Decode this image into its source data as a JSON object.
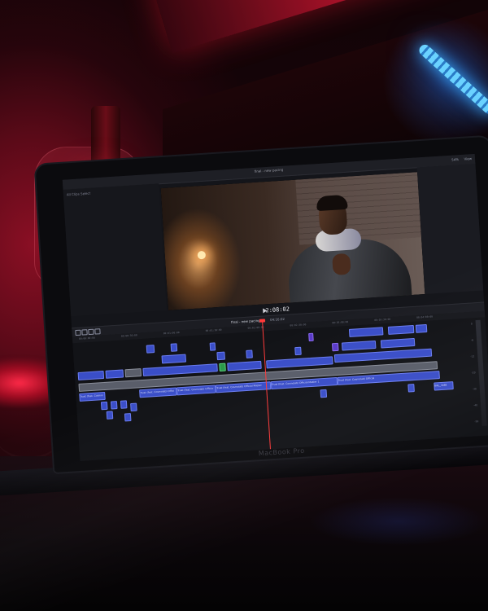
{
  "app": {
    "window_title": "final - new pacing",
    "library_label": "All Clips  Select",
    "zoom": "54%",
    "view_label": "View"
  },
  "viewer": {
    "timecode": "2:08:02"
  },
  "timeline": {
    "project_name": "final - new pacing",
    "duration": "04:16:02",
    "ruler_ticks": [
      "00:00:00:00",
      "00:00:30:00",
      "00:01:00:00",
      "00:01:30:00",
      "00:02:00:00",
      "00:02:30:00",
      "00:03:00:00",
      "00:03:30:00",
      "00:04:00:00"
    ],
    "clip_labels": {
      "primary_1": "Trust (feat. Cosmolab)",
      "primary_2": "Trust (feat. Cosmolab) Official",
      "primary_3": "Trust (feat. Cosmolab) Official",
      "primary_4": "Trust (feat. Cosmolab) Official Master",
      "primary_5": "Trust (feat. Cosmolab) Official Master 1",
      "primary_6": "Trust (feat. Cosmolab) Official",
      "end_clip": "BRL_3488"
    },
    "meter_labels": [
      "0",
      "-6",
      "-12",
      "-20",
      "-30",
      "-40",
      "-50"
    ]
  },
  "device": {
    "brand": "MacBook Pro"
  },
  "colors": {
    "room_red": "#c0142e",
    "led_blue": "#3aa8ff",
    "clip_blue": "#3a4ec8",
    "playhead_red": "#ff3a3a"
  }
}
